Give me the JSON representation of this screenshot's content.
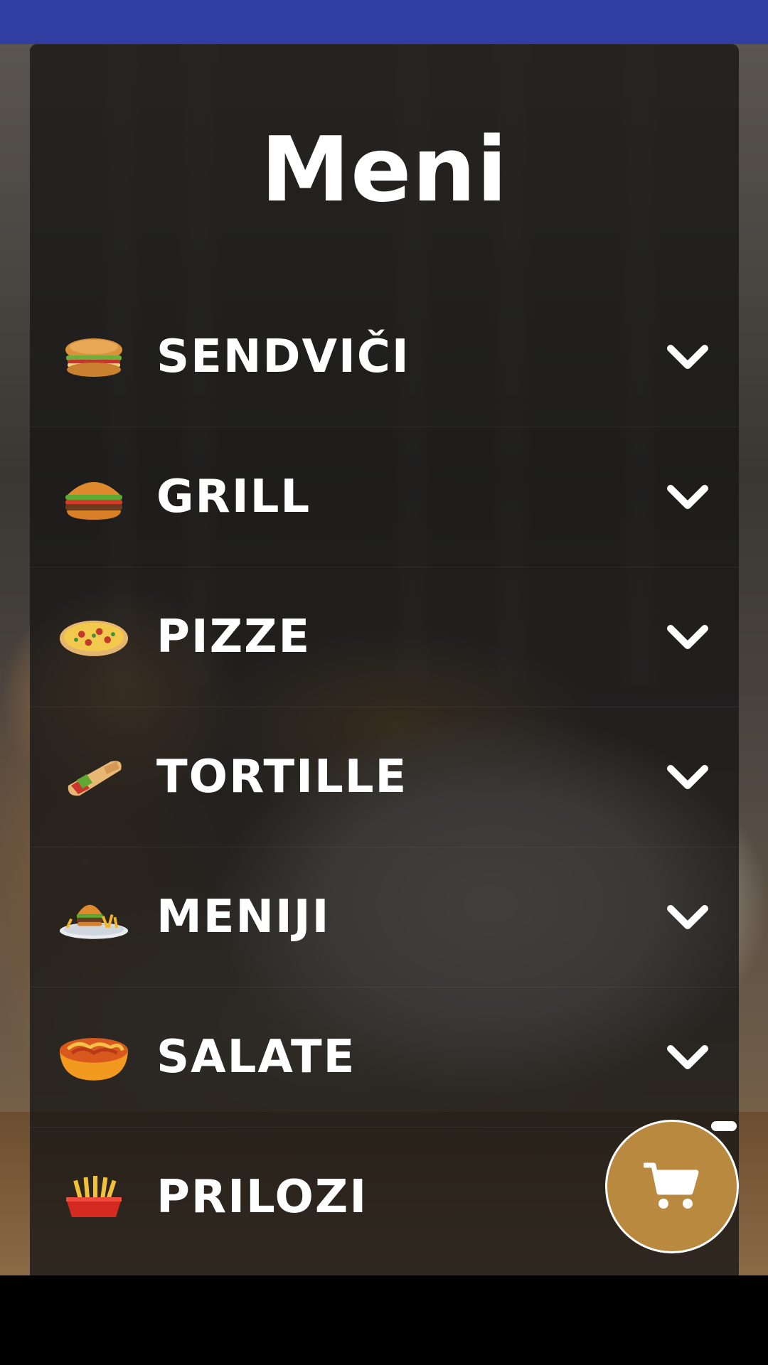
{
  "app": {
    "title": "Meni"
  },
  "menu": {
    "items": [
      {
        "label": "SENDVIČI",
        "icon": "sandwich-icon"
      },
      {
        "label": "GRILL",
        "icon": "burger-icon"
      },
      {
        "label": "PIZZE",
        "icon": "pizza-icon"
      },
      {
        "label": "TORTILLE",
        "icon": "tortilla-icon"
      },
      {
        "label": "MENIJI",
        "icon": "menu-plate-icon"
      },
      {
        "label": "SALATE",
        "icon": "salad-bowl-icon"
      },
      {
        "label": "PRILOZI",
        "icon": "fries-icon"
      }
    ]
  },
  "colors": {
    "status_bar": "#2f3ea0",
    "cart_button": "#b8893f",
    "text": "#ffffff"
  }
}
